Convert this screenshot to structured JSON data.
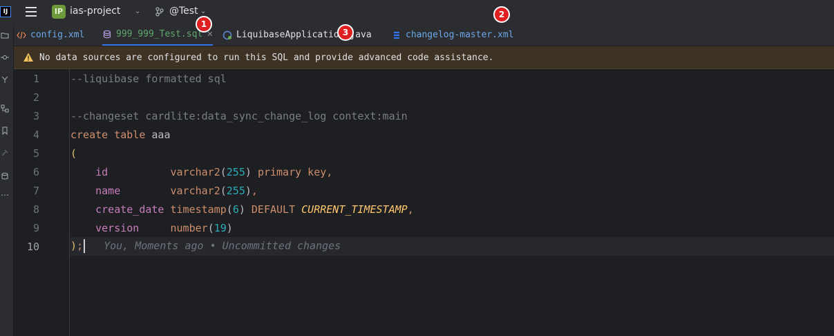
{
  "titlebar": {
    "app_logo": "IJ",
    "project_badge": "IP",
    "project_name": "ias-project",
    "branch": "@Test"
  },
  "tabs": [
    {
      "label": "config.xml",
      "icon": "xml-icon",
      "color": "#6da8e8"
    },
    {
      "label": "999_999_Test.sql",
      "icon": "database-icon",
      "color": "#62a86a",
      "active": true
    },
    {
      "label": "LiquibaseApplication.java",
      "icon": "spring-class-icon",
      "color": "#dfe1e5"
    },
    {
      "label": "changelog-master.xml",
      "icon": "liquibase-icon",
      "color": "#6da8e8"
    }
  ],
  "banner": {
    "text": "No data sources are configured to run this SQL and provide advanced code assistance."
  },
  "editor": {
    "line_numbers": [
      "1",
      "2",
      "3",
      "4",
      "5",
      "6",
      "7",
      "8",
      "9",
      "10"
    ],
    "blame": "You, Moments ago • Uncommitted changes"
  },
  "markers": [
    "1",
    "2",
    "3"
  ],
  "colors": {
    "accent": "#3574f0",
    "marker": "#e02020",
    "banner_bg": "#3d3223"
  }
}
